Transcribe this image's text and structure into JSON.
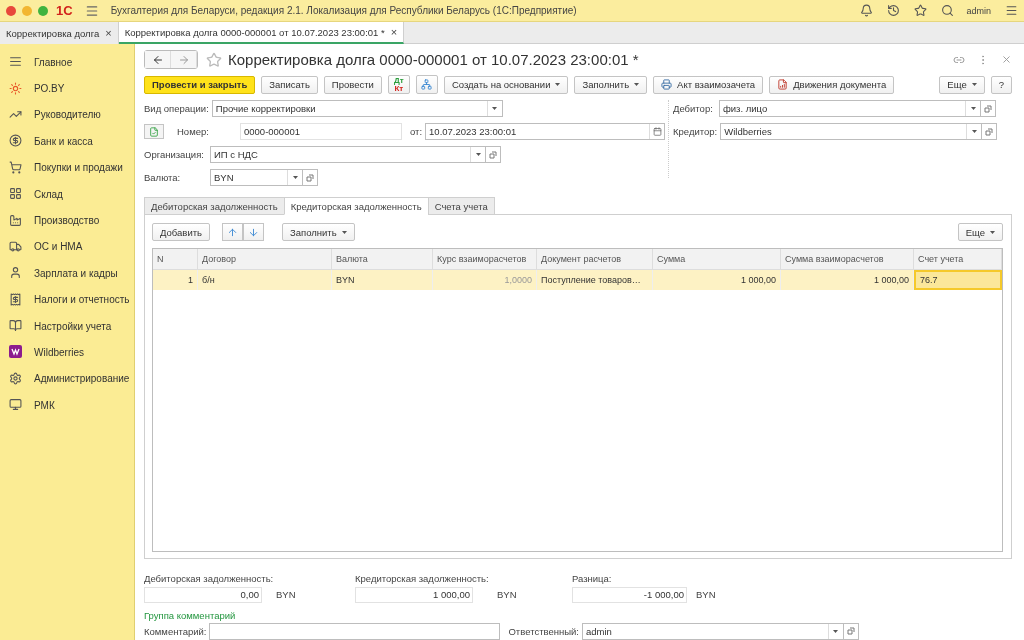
{
  "app": {
    "logo": "1С",
    "title": "Бухгалтерия для Беларуси, редакция 2.1. Локализация для Республики Беларусь  (1С:Предприятие)",
    "user": "admin"
  },
  "open_tabs": [
    {
      "label": "Корректировка долга",
      "close": "×",
      "selected": false
    },
    {
      "label": "Корректировка долга 0000-000001 от 10.07.2023 23:00:01 *",
      "close": "×",
      "selected": true
    }
  ],
  "sidebar": {
    "items": [
      {
        "label": "Главное"
      },
      {
        "label": "РО.BY"
      },
      {
        "label": "Руководителю"
      },
      {
        "label": "Банк и касса"
      },
      {
        "label": "Покупки и продажи"
      },
      {
        "label": "Склад"
      },
      {
        "label": "Производство"
      },
      {
        "label": "ОС и НМА"
      },
      {
        "label": "Зарплата и кадры"
      },
      {
        "label": "Налоги и отчетность"
      },
      {
        "label": "Настройки учета"
      },
      {
        "label": "Wildberries"
      },
      {
        "label": "Администрирование"
      },
      {
        "label": "РМК"
      }
    ]
  },
  "document": {
    "title": "Корректировка долга 0000-000001 от 10.07.2023 23:00:01 *",
    "toolbar": [
      {
        "kind": "primary",
        "label": "Провести и закрыть"
      },
      {
        "kind": "plain",
        "label": "Записать"
      },
      {
        "kind": "plain",
        "label": "Провести"
      },
      {
        "kind": "dtkt",
        "label": "Дт",
        "label_bottom": "Кт"
      },
      {
        "kind": "structure"
      },
      {
        "kind": "dropdown",
        "label": "Создать на основании"
      },
      {
        "kind": "dropdown",
        "label": "Заполнить"
      },
      {
        "kind": "print",
        "label": "Акт взаимозачета"
      },
      {
        "kind": "report",
        "label": "Движения документа"
      }
    ],
    "toolbar_right": [
      {
        "kind": "dropdown",
        "label": "Еще"
      },
      {
        "kind": "plain",
        "label": "?"
      }
    ],
    "operation": {
      "label": "Вид операции:",
      "value": "Прочие корректировки"
    },
    "number": {
      "label": "Номер:",
      "value": "0000-000001"
    },
    "date": {
      "label": "от:",
      "value": "10.07.2023 23:00:01"
    },
    "organization": {
      "label": "Организация:",
      "value": "ИП с НДС"
    },
    "currency": {
      "label": "Валюта:",
      "value": "BYN"
    },
    "debtor": {
      "label": "Дебитор:",
      "value": "физ. лицо"
    },
    "creditor": {
      "label": "Кредитор:",
      "value": "Wildberries"
    }
  },
  "sections": [
    {
      "label": "Дебиторская задолженность",
      "selected": false
    },
    {
      "label": "Кредиторская задолженность",
      "selected": true
    },
    {
      "label": "Счета учета",
      "selected": false
    }
  ],
  "table": {
    "add": "Добавить",
    "fill": "Заполнить",
    "more": "Еще",
    "columns": [
      "N",
      "Договор",
      "Валюта",
      "Курс взаиморасчетов",
      "Документ расчетов",
      "Сумма",
      "Сумма взаиморасчетов",
      "Счет учета"
    ],
    "rows": [
      {
        "selected": true,
        "cells": [
          {
            "text": "1",
            "selected": false
          },
          {
            "text": "б/н",
            "selected": false
          },
          {
            "text": "BYN",
            "selected": false
          },
          {
            "text": "1,0000",
            "selected": false
          },
          {
            "text": "Поступление товаров…",
            "selected": false
          },
          {
            "text": "1 000,00",
            "selected": false
          },
          {
            "text": "1 000,00",
            "selected": false
          },
          {
            "text": "76.7",
            "selected": true
          }
        ]
      }
    ]
  },
  "totals": [
    {
      "label": "Дебиторская задолженность:",
      "value": "0,00",
      "currency": "BYN"
    },
    {
      "label": "Кредиторская задолженность:",
      "value": "1 000,00",
      "currency": "BYN"
    },
    {
      "label": "Разница:",
      "value": "-1 000,00",
      "currency": "BYN"
    }
  ],
  "comments": {
    "group_label": "Группа комментарий",
    "comment_label": "Комментарий:",
    "responsible": {
      "label": "Ответственный:",
      "value": "admin"
    }
  }
}
